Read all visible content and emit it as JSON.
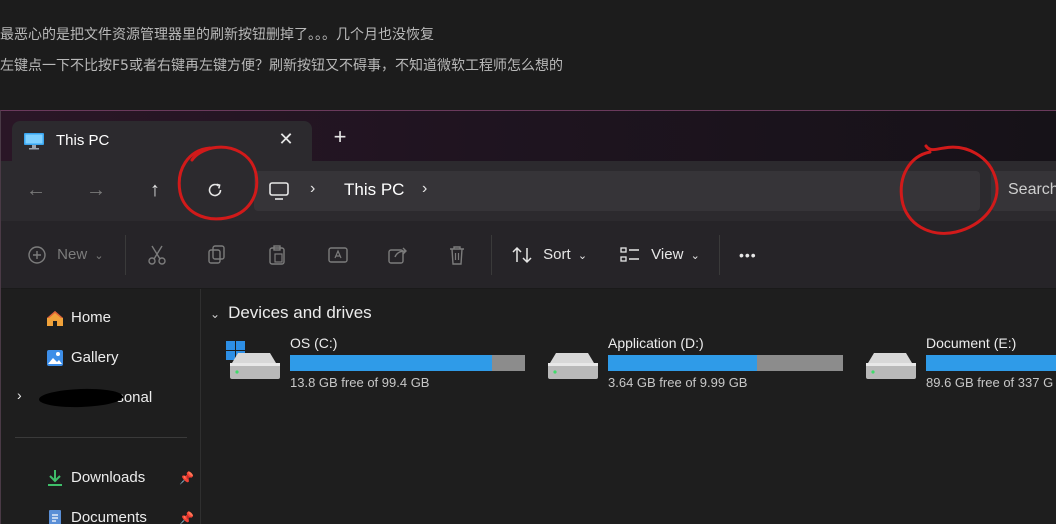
{
  "post": {
    "line1": "最恶心的是把文件资源管理器里的刷新按钮删掉了。。。几个月也没恢复",
    "line2": "左键点一下不比按F5或者右键再左键方便？刷新按钮又不碍事，不知道微软工程师怎么想的"
  },
  "tab": {
    "title": "This PC",
    "close_glyph": "✕",
    "new_glyph": "+",
    "icon": "monitor-icon"
  },
  "nav": {
    "back_glyph": "←",
    "forward_glyph": "→",
    "up_glyph": "↑",
    "address_label": "This PC",
    "search_label": "Search"
  },
  "toolbar": {
    "new_label": "New",
    "sort_label": "Sort",
    "view_label": "View",
    "more_glyph": "•••"
  },
  "sidebar": {
    "items": [
      {
        "label": "Home",
        "icon": "home-icon"
      },
      {
        "label": "Gallery",
        "icon": "gallery-icon"
      },
      {
        "label": "Personal",
        "icon": "onedrive-icon"
      },
      {
        "label": "Downloads",
        "icon": "download-icon"
      },
      {
        "label": "Documents",
        "icon": "document-icon"
      }
    ],
    "expand_glyph": "›"
  },
  "main": {
    "group_title": "Devices and drives",
    "drives": [
      {
        "name": "OS (C:)",
        "free": "13.8 GB free of 99.4 GB",
        "used_fraction": 0.861
      },
      {
        "name": "Application (D:)",
        "free": "3.64 GB free of 9.99 GB",
        "used_fraction": 0.636
      },
      {
        "name": "Document (E:)",
        "free": "89.6 GB free of 337 G",
        "used_fraction": 0.734
      }
    ]
  },
  "colors": {
    "accent": "#2f9be8",
    "annotation": "#d11a1a"
  }
}
